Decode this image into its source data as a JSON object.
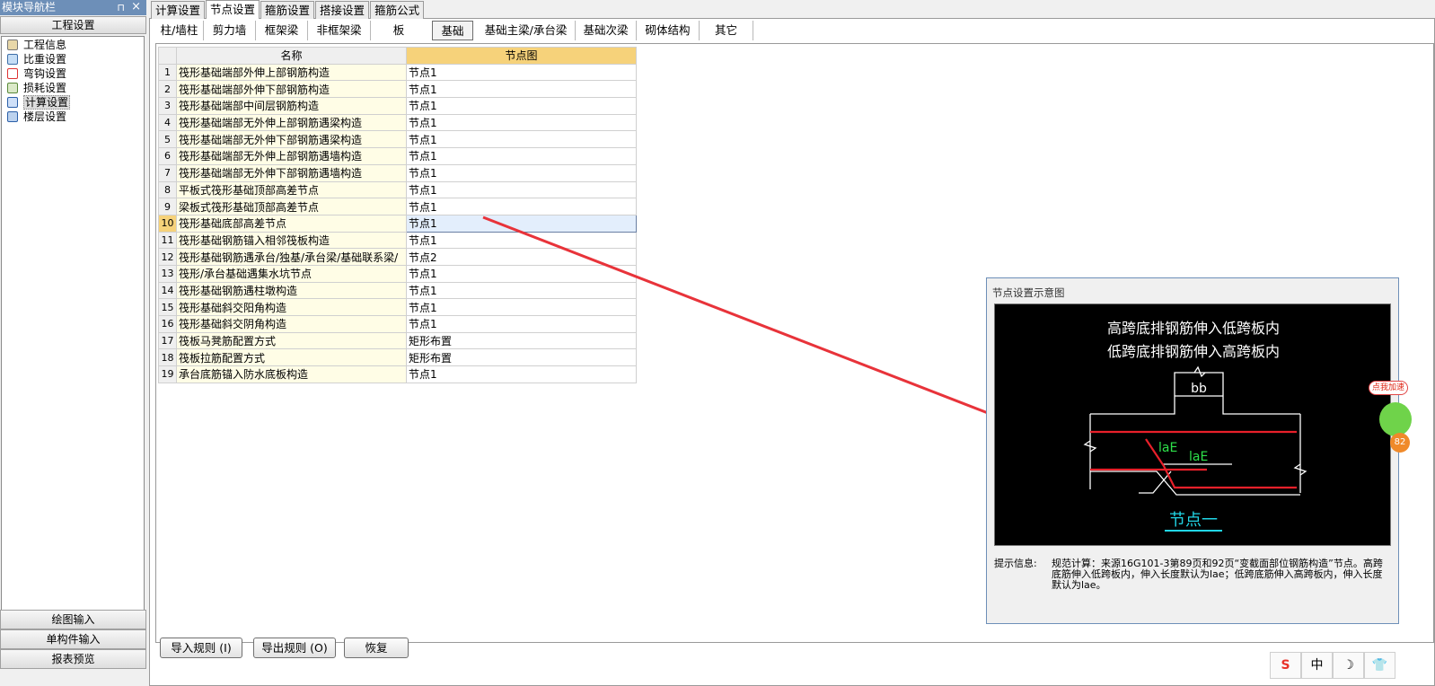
{
  "nav": {
    "title": "模块导航栏",
    "pin": "⊓",
    "close": "×",
    "section_header": "工程设置",
    "tree": [
      {
        "label": "工程信息",
        "icon": "project-info-icon"
      },
      {
        "label": "比重设置",
        "icon": "ratio-icon"
      },
      {
        "label": "弯钩设置",
        "icon": "hook-icon"
      },
      {
        "label": "损耗设置",
        "icon": "loss-icon"
      },
      {
        "label": "计算设置",
        "icon": "calc-icon"
      },
      {
        "label": "楼层设置",
        "icon": "floor-icon"
      }
    ],
    "bottom": [
      "绘图输入",
      "单构件输入",
      "报表预览"
    ]
  },
  "tabs": [
    "计算设置",
    "节点设置",
    "箍筋设置",
    "搭接设置",
    "箍筋公式"
  ],
  "subtabs": [
    "柱/墙柱",
    "剪力墙",
    "框架梁",
    "非框架梁",
    "板",
    "基础",
    "基础主梁/承台梁",
    "基础次梁",
    "砌体结构",
    "其它"
  ],
  "grid": {
    "headers": {
      "name": "名称",
      "node": "节点图"
    },
    "rows": [
      {
        "n": "1",
        "name": "筏形基础端部外伸上部钢筋构造",
        "val": "节点1"
      },
      {
        "n": "2",
        "name": "筏形基础端部外伸下部钢筋构造",
        "val": "节点1"
      },
      {
        "n": "3",
        "name": "筏形基础端部中间层钢筋构造",
        "val": "节点1"
      },
      {
        "n": "4",
        "name": "筏形基础端部无外伸上部钢筋遇梁构造",
        "val": "节点1"
      },
      {
        "n": "5",
        "name": "筏形基础端部无外伸下部钢筋遇梁构造",
        "val": "节点1"
      },
      {
        "n": "6",
        "name": "筏形基础端部无外伸上部钢筋遇墙构造",
        "val": "节点1"
      },
      {
        "n": "7",
        "name": "筏形基础端部无外伸下部钢筋遇墙构造",
        "val": "节点1"
      },
      {
        "n": "8",
        "name": "平板式筏形基础顶部高差节点",
        "val": "节点1"
      },
      {
        "n": "9",
        "name": "梁板式筏形基础顶部高差节点",
        "val": "节点1"
      },
      {
        "n": "10",
        "name": "筏形基础底部高差节点",
        "val": "节点1"
      },
      {
        "n": "11",
        "name": "筏形基础钢筋锚入相邻筏板构造",
        "val": "节点1"
      },
      {
        "n": "12",
        "name": "筏形基础钢筋遇承台/独基/承台梁/基础联系梁/",
        "val": "节点2"
      },
      {
        "n": "13",
        "name": "筏形/承台基础遇集水坑节点",
        "val": "节点1"
      },
      {
        "n": "14",
        "name": "筏形基础钢筋遇柱墩构造",
        "val": "节点1"
      },
      {
        "n": "15",
        "name": "筏形基础斜交阳角构造",
        "val": "节点1"
      },
      {
        "n": "16",
        "name": "筏形基础斜交阴角构造",
        "val": "节点1"
      },
      {
        "n": "17",
        "name": "筏板马凳筋配置方式",
        "val": "矩形布置"
      },
      {
        "n": "18",
        "name": "筏板拉筋配置方式",
        "val": "矩形布置"
      },
      {
        "n": "19",
        "name": "承台底筋锚入防水底板构造",
        "val": "节点1"
      }
    ]
  },
  "preview": {
    "title": "节点设置示意图",
    "line1": "高跨底排钢筋伸入低跨板内",
    "line2": "低跨底排钢筋伸入高跨板内",
    "bb": "bb",
    "lae1": "laE",
    "lae2": "laE",
    "caption": "节点一",
    "hint_label": "提示信息:",
    "hint_text": "规范计算：来源16G101-3第89页和92页“变截面部位钢筋构造”节点。高跨底筋伸入低跨板内，伸入长度默认为lae；低跨底筋伸入高跨板内，伸入长度默认为lae。"
  },
  "buttons": {
    "import": "导入规则 (I)",
    "export": "导出规则 (O)",
    "restore": "恢复"
  },
  "floating": {
    "badge": "点我加速",
    "count": "82"
  },
  "ime": {
    "logo": "S",
    "lang": "中",
    "moon": "☽",
    "shirt": "👕"
  },
  "colors": {
    "accent": "#6d8fb8",
    "header_node": "#f6d27a",
    "arrow": "#e8333a",
    "rebar": "#e8202a",
    "dim": "#2ee04a",
    "caption": "#21d6e6"
  }
}
